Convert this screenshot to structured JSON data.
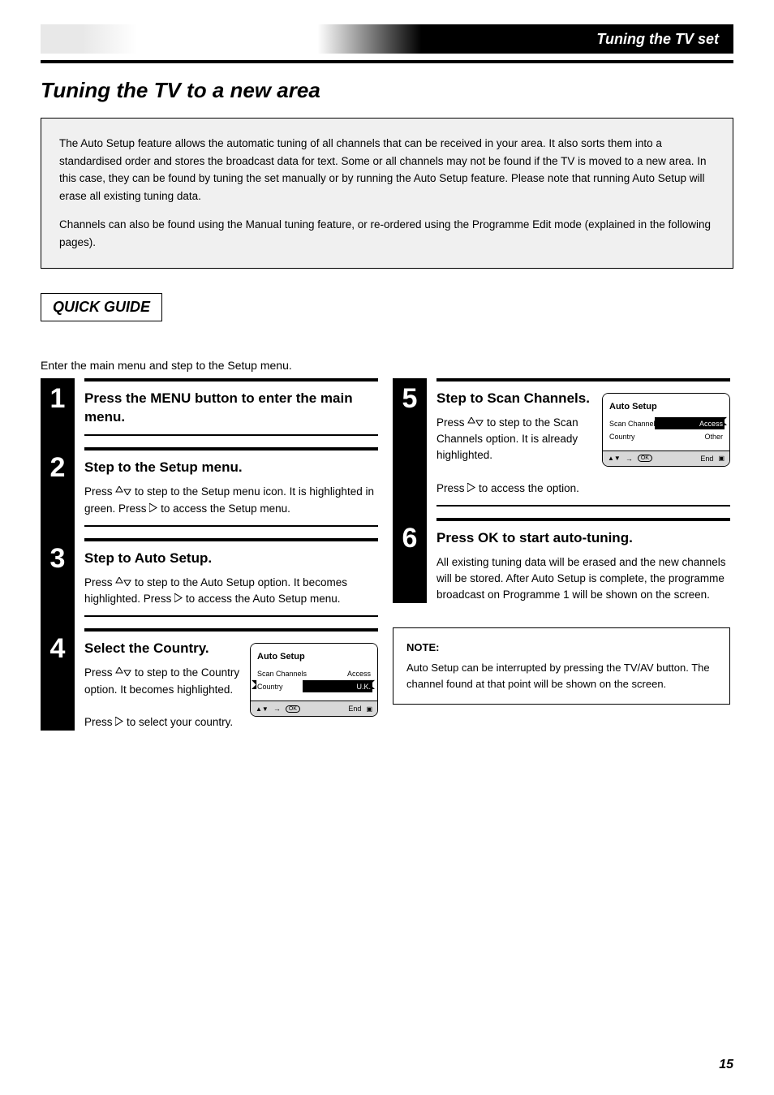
{
  "chapter": "Tuning the TV set",
  "main_title": "Tuning the TV to a new area",
  "infobox": {
    "p1": "The Auto Setup feature allows the automatic tuning of all channels that can be received in your area. It also sorts them into a standardised order and stores the broadcast data for text. Some or all channels may not be found if the TV is moved to a new area. In this case, they can be found by tuning the set manually or by running the Auto Setup feature. Please note that running Auto Setup will erase all existing tuning data.",
    "p2": "Channels can also be found using the Manual tuning feature, or re-ordered using the Programme Edit mode (explained in the following pages)."
  },
  "quick_guide_label": "QUICK GUIDE",
  "intro": "Enter the main menu and step to the Setup menu.",
  "steps": {
    "s1": {
      "title_a": "Press the ",
      "title_b": " button to enter the main menu.",
      "menu_word": "MENU"
    },
    "s2": {
      "title": "Step to the Setup menu.",
      "desc_a": "Press ",
      "desc_b": " to step to the Setup menu icon. It is highlighted in green. Press ",
      "desc_c": " to access the Setup menu."
    },
    "s3": {
      "title": "Step to Auto Setup.",
      "desc_a": "Press ",
      "desc_b": " to step to the Auto Setup option. It becomes highlighted. Press ",
      "desc_c": " to access the Auto Setup menu."
    },
    "s4": {
      "title": "Select the Country.",
      "desc_a": "Press ",
      "desc_b": " to step to the Country option. It becomes highlighted.",
      "desc_c": "Press ",
      "desc_d": " to select your country."
    },
    "s5": {
      "title": "Step to Scan Channels.",
      "desc_a": "Press ",
      "desc_b": " to step to the Scan Channels option. It is already highlighted.",
      "desc_c": "Press ",
      "desc_d": " to access the option."
    },
    "s6": {
      "title_a": "Press ",
      "title_b": " to start auto-tuning.",
      "ok_word": "OK",
      "desc": "All existing tuning data will be erased and the new channels will be stored. After Auto Setup is complete, the programme broadcast on Programme 1 will be shown on the screen."
    }
  },
  "screen": {
    "title": "Auto Setup",
    "scan_label": "Scan Channels",
    "scan_value": "Access",
    "country_label": "Country",
    "country_value_uk": "U.K.",
    "country_value_other": "Other",
    "footer_end": "End"
  },
  "note": {
    "title": "NOTE:",
    "body": "Auto Setup can be interrupted by pressing the TV/AV button. The channel found at that point will be shown on the screen."
  },
  "page_number": "15"
}
